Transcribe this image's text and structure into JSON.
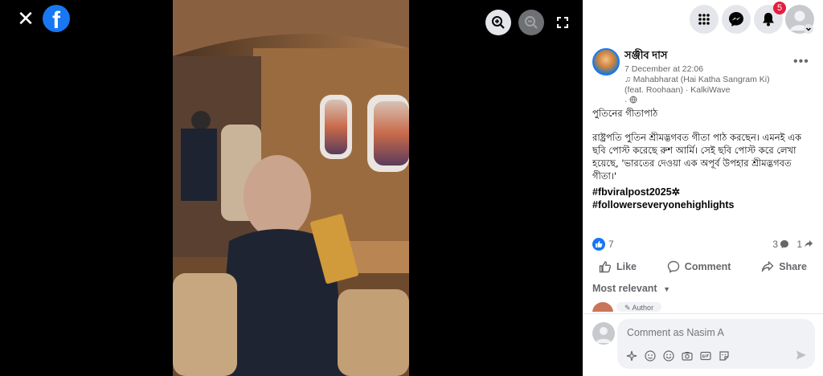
{
  "viewer": {
    "close_glyph": "✕",
    "logo_letter": "f"
  },
  "notifications": {
    "badge_count": "5"
  },
  "post": {
    "author": "সঞ্জীব দাস",
    "date": "7 December at 22:06",
    "music": "Mahabharat (Hai Katha Sangram Ki) (feat. Roohaan) · KalkiWave",
    "privacy_sep": "·",
    "title_line": "পুতিনের গীতাপাঠ",
    "body": "রাষ্ট্রপতি পুতিন শ্রীমদ্ভগবত গীতা পাঠ করছেন। এমনই এক ছবি পোস্ট করেছে রুশ আর্মি। সেই ছবি পোস্ট করে লেখা হয়েছে, 'ভারতের দেওয়া এক অপূর্ব উপহার শ্রীমদ্ভগবত গীতা।'",
    "hashtags": [
      "#fbviralpost2025",
      "#followerseveryonehighlights"
    ],
    "hashtag_suffix": "✲"
  },
  "stats": {
    "reactions": "7",
    "comments": "3",
    "shares": "1"
  },
  "actions": {
    "like": "Like",
    "comment": "Comment",
    "share": "Share"
  },
  "sort": {
    "label": "Most relevant"
  },
  "preview": {
    "author_tag": "Author"
  },
  "composer": {
    "placeholder": "Comment as Nasim A"
  },
  "colors": {
    "accent": "#1877f2",
    "badge": "#e41e3f",
    "muted": "#65676b"
  },
  "icons": [
    "close-icon",
    "facebook-logo",
    "zoom-in-icon",
    "zoom-out-icon",
    "fullscreen-icon",
    "menu-grid-icon",
    "messenger-icon",
    "bell-icon",
    "avatar",
    "globe-icon",
    "music-icon",
    "like-icon",
    "comment-icon",
    "share-icon",
    "sticker-icon",
    "emoji-icon",
    "camera-icon",
    "gif-icon",
    "send-icon"
  ]
}
